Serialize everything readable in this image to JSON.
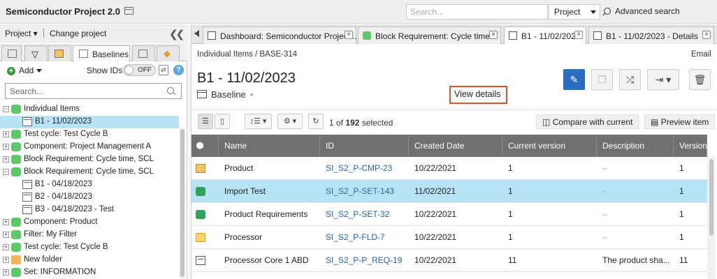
{
  "app": {
    "title": "Semiconductor Project 2.0",
    "search_placeholder": "Search...",
    "search_scope": "Project",
    "advanced_search": "Advanced search"
  },
  "left": {
    "menu": {
      "project": "Project ▾",
      "change_project": "Change project"
    },
    "tabs": {
      "baselines": "Baselines"
    },
    "add_label": "Add",
    "show_ids_label": "Show IDs",
    "toggle_state": "OFF",
    "search_placeholder": "Search...",
    "tree": [
      {
        "label": "Individual Items",
        "icon": "database-icon",
        "expander": "−",
        "indent": 0
      },
      {
        "label": "B1 - 11/02/2023",
        "icon": "baseline-icon",
        "expander": "",
        "indent": 1,
        "selected": true
      },
      {
        "label": "Test cycle: Test Cycle B",
        "icon": "database-icon",
        "expander": "+",
        "indent": 0
      },
      {
        "label": "Component: Project Management A",
        "icon": "database-icon",
        "expander": "+",
        "indent": 0
      },
      {
        "label": "Block Requirement: Cycle time, SCL",
        "icon": "database-icon",
        "expander": "+",
        "indent": 0
      },
      {
        "label": "Block Requirement: Cycle time, SCL",
        "icon": "database-icon",
        "expander": "−",
        "indent": 0
      },
      {
        "label": "B1 - 04/18/2023",
        "icon": "baseline-icon",
        "expander": "",
        "indent": 1
      },
      {
        "label": "B2 - 04/18/2023",
        "icon": "baseline-icon",
        "expander": "",
        "indent": 1
      },
      {
        "label": "B3 - 04/18/2023 - Test",
        "icon": "baseline-icon",
        "expander": "",
        "indent": 1
      },
      {
        "label": "Component: Product",
        "icon": "database-icon",
        "expander": "+",
        "indent": 0
      },
      {
        "label": "Filter: My Filter",
        "icon": "database-icon",
        "expander": "+",
        "indent": 0
      },
      {
        "label": "Test cycle: Test Cycle B",
        "icon": "database-icon",
        "expander": "+",
        "indent": 0
      },
      {
        "label": "New folder",
        "icon": "folder-icon",
        "expander": "+",
        "indent": 0
      },
      {
        "label": "Set: INFORMATION",
        "icon": "database-icon",
        "expander": "+",
        "indent": 0
      }
    ]
  },
  "tabs": [
    {
      "label": "Dashboard: Semiconductor Project...",
      "icon": "dashboard-icon"
    },
    {
      "label": "Block Requirement: Cycle time...",
      "icon": "database-icon"
    },
    {
      "label": "B1 - 11/02/2023",
      "icon": "baseline-icon",
      "active": true
    },
    {
      "label": "B1 - 11/02/2023 - Details",
      "icon": "baseline-icon"
    }
  ],
  "main": {
    "breadcrumb": "Individual Items  /  BASE-314",
    "email": "Email",
    "title": "B1 - 11/02/2023",
    "type_label": "Baseline",
    "view_details": "View details",
    "selected_count": "1",
    "total_count": "192",
    "selected_suffix": "selected",
    "of_label": "of",
    "compare": "Compare with current",
    "preview": "Preview item"
  },
  "grid": {
    "columns": [
      "Name",
      "ID",
      "Created Date",
      "Current version",
      "Description",
      "Version"
    ],
    "rows": [
      {
        "icon": "component-icon",
        "name": "Product",
        "id": "SI_S2_P-CMP-23",
        "created": "10/22/2021",
        "current": "1",
        "description": "–",
        "version": "1"
      },
      {
        "icon": "set-icon",
        "name": "Import Test",
        "id": "SI_S2_P-SET-143",
        "created": "11/02/2021",
        "current": "1",
        "description": "–",
        "version": "1",
        "selected": true
      },
      {
        "icon": "set-icon",
        "name": "Product Requirements",
        "id": "SI_S2_P-SET-32",
        "created": "10/22/2021",
        "current": "1",
        "description": "–",
        "version": "1"
      },
      {
        "icon": "folder-icon",
        "name": "Processor",
        "id": "SI_S2_P-FLD-7",
        "created": "10/22/2021",
        "current": "1",
        "description": "–",
        "version": "1"
      },
      {
        "icon": "requirement-icon",
        "name": "Processor Core 1 ABD",
        "id": "SI_S2_P-P_REQ-19",
        "created": "10/22/2021",
        "current": "11",
        "description": "The product sha...",
        "version": "11"
      }
    ]
  }
}
